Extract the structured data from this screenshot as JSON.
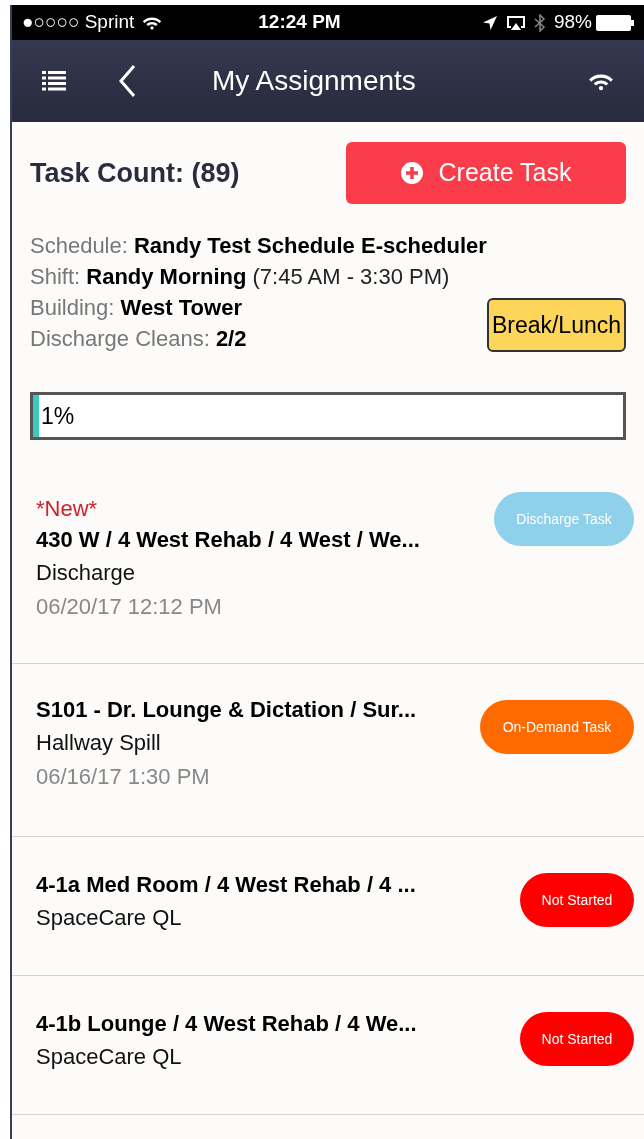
{
  "status_bar": {
    "carrier": "●○○○○ Sprint",
    "time": "12:24 PM",
    "battery": "98%"
  },
  "nav_bar": {
    "title": "My Assignments"
  },
  "task_count": "Task Count: (89)",
  "create_button": "Create Task",
  "info": [
    {
      "label": "Schedule:",
      "value": "Randy Test Schedule E-scheduler"
    },
    {
      "label": "Shift:",
      "value": "Randy Morning",
      "note": "(7:45 AM - 3:30 PM)"
    },
    {
      "label": "Building:",
      "value": "West Tower"
    },
    {
      "label": "Discharge Cleans:",
      "value": "2/2"
    }
  ],
  "break_button": "Break/Lunch",
  "progress": {
    "level": 0.01,
    "reading": "1%"
  },
  "tasks": [
    {
      "flag": "*New*",
      "title": "430 W / 4 West Rehab / 4 West / We...",
      "subtitle": "Discharge",
      "time": "06/20/17 12:12 PM",
      "badge": "Discharge Task",
      "color": "#8fd0ea"
    },
    {
      "title": "S101 - Dr. Lounge & Dictation / Sur...",
      "subtitle": "Hallway Spill",
      "time": "06/16/17 1:30 PM",
      "badge": "On-Demand Task",
      "color": "#ff6a00"
    },
    {
      "title": "4-1a Med Room / 4 West Rehab / 4 ...",
      "subtitle": "SpaceCare QL",
      "badge": "Not Started",
      "color": "#ff0000"
    },
    {
      "title": "4-1b Lounge / 4 West Rehab / 4 We...",
      "subtitle": "SpaceCare QL",
      "badge": "Not Started",
      "color": "#ff0000"
    }
  ]
}
